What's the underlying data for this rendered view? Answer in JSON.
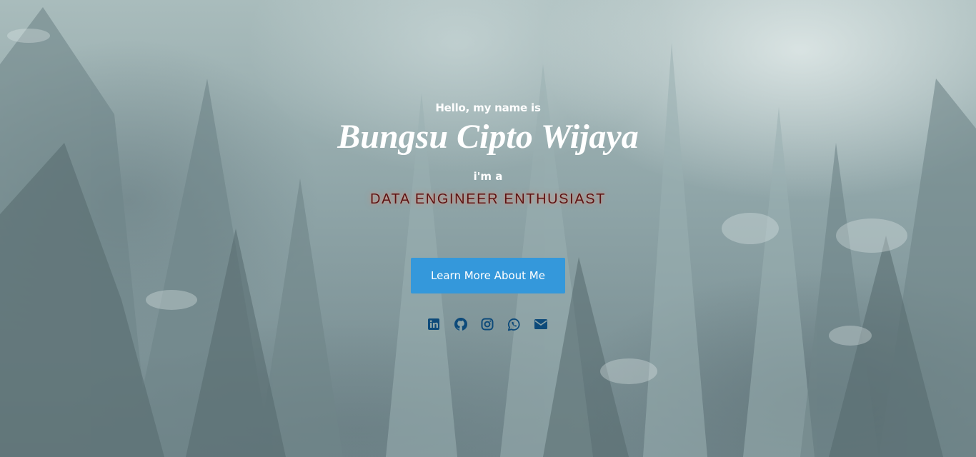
{
  "hero": {
    "greeting": "Hello, my name is",
    "name": "Bungsu Cipto Wijaya",
    "intro": "i'm a",
    "role": "DATA ENGINEER ENTHUSIAST",
    "cta_label": "Learn More About Me"
  },
  "socials": [
    {
      "icon": "linkedin-icon"
    },
    {
      "icon": "github-icon"
    },
    {
      "icon": "instagram-icon"
    },
    {
      "icon": "whatsapp-icon"
    },
    {
      "icon": "envelope-icon"
    }
  ],
  "colors": {
    "accent": "#3498db",
    "icon": "#0d4a7a",
    "role_text": "#5a1414",
    "heading_text": "#ffffff"
  }
}
